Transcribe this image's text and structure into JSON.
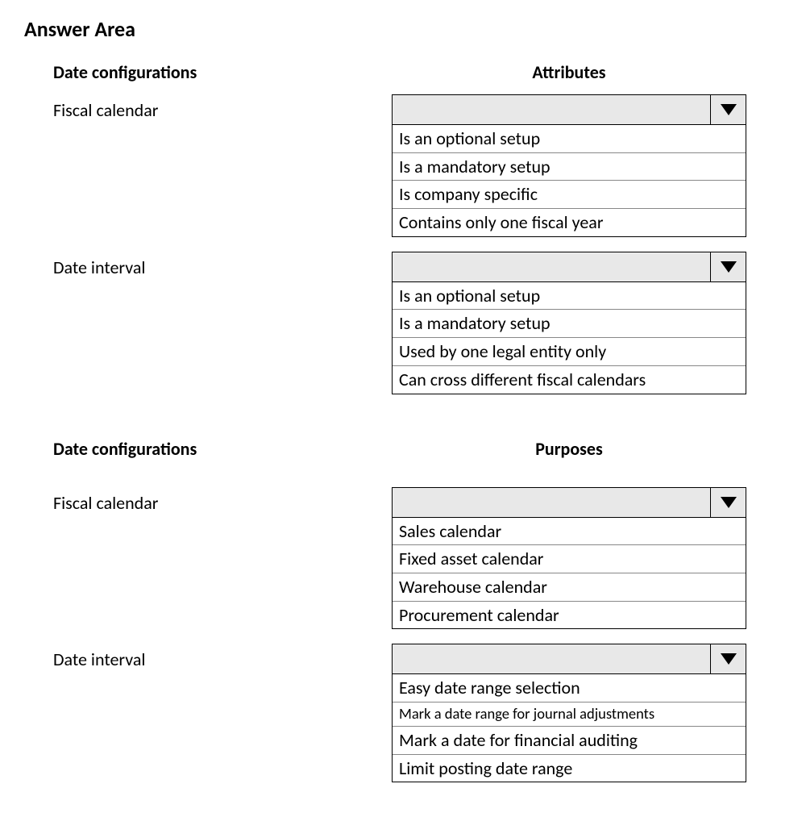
{
  "title": "Answer Area",
  "section1": {
    "left_header": "Date configurations",
    "right_header": "Attributes",
    "rows": [
      {
        "label": "Fiscal calendar",
        "options": [
          "Is an optional setup",
          "Is a mandatory setup",
          "Is company specific",
          "Contains only one fiscal year"
        ]
      },
      {
        "label": "Date interval",
        "options": [
          "Is an optional setup",
          "Is a mandatory setup",
          "Used by one legal entity only",
          "Can cross different fiscal calendars"
        ]
      }
    ]
  },
  "section2": {
    "left_header": "Date configurations",
    "right_header": "Purposes",
    "rows": [
      {
        "label": "Fiscal calendar",
        "options": [
          "Sales calendar",
          "Fixed asset calendar",
          "Warehouse calendar",
          "Procurement calendar"
        ]
      },
      {
        "label": "Date interval",
        "options": [
          "Easy date range selection",
          "Mark a date range for journal adjustments",
          "Mark a date for financial auditing",
          "Limit posting date range"
        ]
      }
    ]
  }
}
